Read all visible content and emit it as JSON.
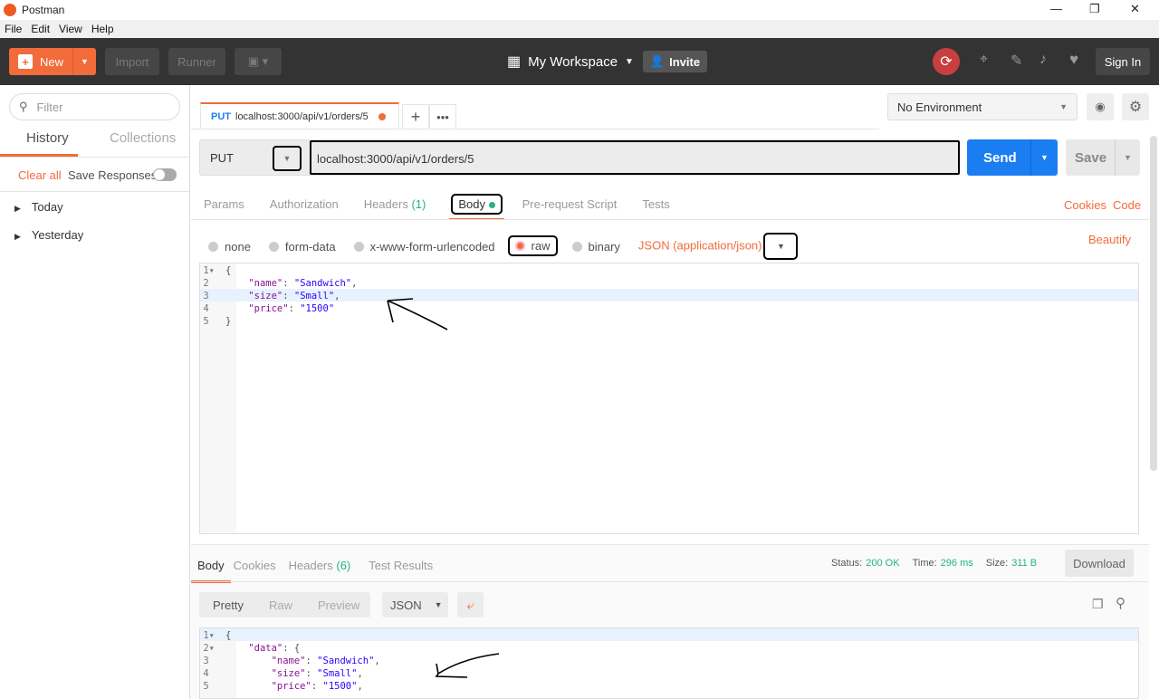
{
  "window": {
    "title": "Postman",
    "minimize": "—",
    "restore": "❐",
    "close": "✕"
  },
  "menu": [
    "File",
    "Edit",
    "View",
    "Help"
  ],
  "toolbar": {
    "new": "New",
    "import": "Import",
    "runner": "Runner",
    "workspace": "My Workspace",
    "invite": "Invite",
    "sign_in": "Sign In"
  },
  "sidebar": {
    "filter_placeholder": "Filter",
    "tabs": [
      "History",
      "Collections"
    ],
    "clear_all": "Clear all",
    "save_responses": "Save Responses",
    "groups": [
      "Today",
      "Yesterday"
    ]
  },
  "tab": {
    "method": "PUT",
    "url": "localhost:3000/api/v1/orders/5"
  },
  "environment": {
    "selected": "No Environment"
  },
  "request": {
    "method": "PUT",
    "url": "localhost:3000/api/v1/orders/5",
    "send": "Send",
    "save": "Save",
    "tabs": [
      "Params",
      "Authorization",
      "Headers",
      "Body",
      "Pre-request Script",
      "Tests"
    ],
    "headers_count": "(1)",
    "cookies": "Cookies",
    "code": "Code",
    "body_types": [
      "none",
      "form-data",
      "x-www-form-urlencoded",
      "raw",
      "binary"
    ],
    "content_type": "JSON (application/json)",
    "beautify": "Beautify",
    "lines": [
      [
        "{"
      ],
      [
        "    ",
        "\"name\"",
        ": ",
        "\"Sandwich\"",
        ","
      ],
      [
        "    ",
        "\"size\"",
        ": ",
        "\"Small\"",
        ","
      ],
      [
        "    ",
        "\"price\"",
        ": ",
        "\"1500\""
      ],
      [
        "}"
      ]
    ]
  },
  "response": {
    "tabs": [
      "Body",
      "Cookies",
      "Headers",
      "Test Results"
    ],
    "headers_count": "(6)",
    "status_label": "Status:",
    "status": "200 OK",
    "time_label": "Time:",
    "time": "296 ms",
    "size_label": "Size:",
    "size": "311 B",
    "download": "Download",
    "views": [
      "Pretty",
      "Raw",
      "Preview"
    ],
    "format": "JSON",
    "lines": [
      [
        "{"
      ],
      [
        "    ",
        "\"data\"",
        ": {"
      ],
      [
        "        ",
        "\"name\"",
        ": ",
        "\"Sandwich\"",
        ","
      ],
      [
        "        ",
        "\"size\"",
        ": ",
        "\"Small\"",
        ","
      ],
      [
        "        ",
        "\"price\"",
        ": ",
        "\"1500\"",
        ","
      ]
    ]
  },
  "colors": {
    "accent": "#f26b3a",
    "send": "#1a7ef2",
    "green": "#26b47f"
  }
}
